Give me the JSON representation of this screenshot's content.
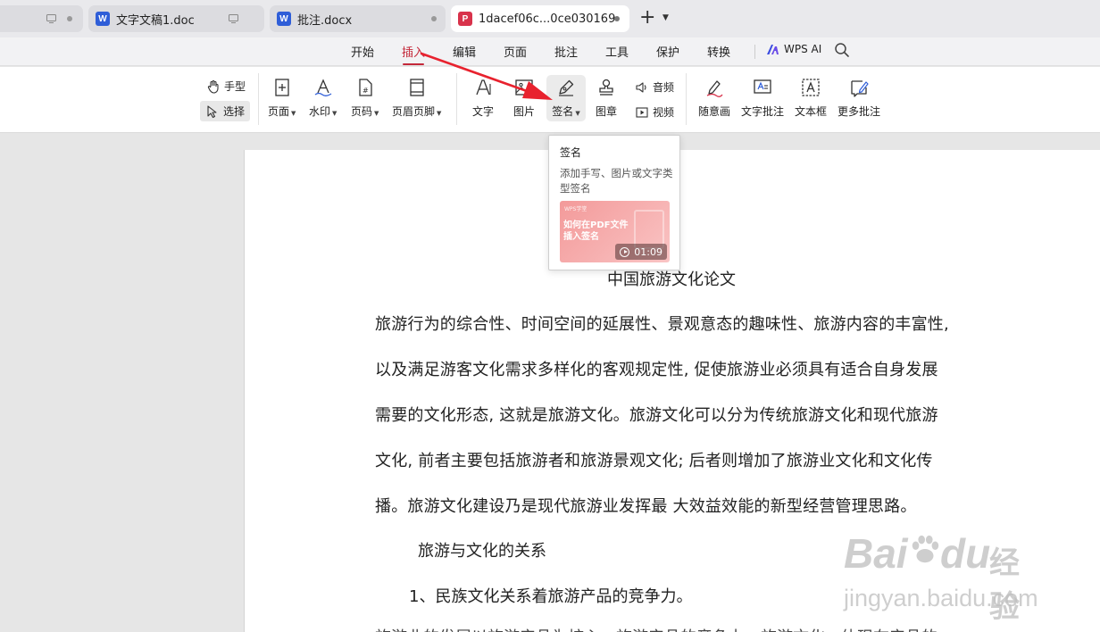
{
  "tabs": [
    {
      "label": "",
      "type": "inactive-edge"
    },
    {
      "label": "文字文稿1.doc",
      "icon": "word-doc-icon",
      "state": "inactive"
    },
    {
      "label": "批注.docx",
      "icon": "word-doc-icon",
      "state": "inactive"
    },
    {
      "label": "1dacef06c...0ce030169",
      "icon": "pdf-doc-icon",
      "state": "active"
    }
  ],
  "tab_icons": {
    "word": "W",
    "pdf": "P"
  },
  "menu": {
    "items": [
      "开始",
      "插入",
      "编辑",
      "页面",
      "批注",
      "工具",
      "保护",
      "转换"
    ],
    "active": "插入",
    "ai_label": "WPS AI"
  },
  "ribbon": {
    "hand": "手型",
    "select": "选择",
    "page": "页面",
    "watermark": "水印",
    "pagenum": "页码",
    "header_footer": "页眉页脚",
    "text": "文字",
    "image": "图片",
    "signature": "签名",
    "stamp": "图章",
    "audio": "音频",
    "video": "视频",
    "freehand": "随意画",
    "text_comment": "文字批注",
    "textbox": "文本框",
    "more_comments": "更多批注"
  },
  "tooltip": {
    "title": "签名",
    "description": "添加手写、图片或文字类型签名",
    "video": {
      "brand": "WPS学堂",
      "title": "如何在PDF文件插入签名",
      "duration": "01:09"
    }
  },
  "document": {
    "title": "中国旅游文化论文",
    "lines": [
      "旅游行为的综合性、时间空间的延展性、景观意态的趣味性、旅游内容的丰富性,",
      "以及满足游客文化需求多样化的客观规定性, 促使旅游业必须具有适合自身发展",
      "需要的文化形态, 这就是旅游文化。旅游文化可以分为传统旅游文化和现代旅游",
      "文化, 前者主要包括旅游者和旅游景观文化; 后者则增加了旅游业文化和文化传",
      "播。旅游文化建设乃是现代旅游业发挥最  大效益效能的新型经营管理思路。"
    ],
    "heading1": "旅游与文化的关系",
    "heading2": "1、民族文化关系着旅游产品的竞争力。",
    "cut_line": "旅游业的发展以旅游产品为核心，旅游产品的竞争力，旅游文化，体现在产品的"
  },
  "watermark": {
    "brand": "Bai",
    "brand2": "du",
    "service": "经验",
    "url": "jingyan.baidu.com"
  },
  "colors": {
    "accent": "#c4293a",
    "arrow": "#e8222e",
    "word_blue": "#2f5ed8",
    "pdf_red": "#d8324b"
  }
}
